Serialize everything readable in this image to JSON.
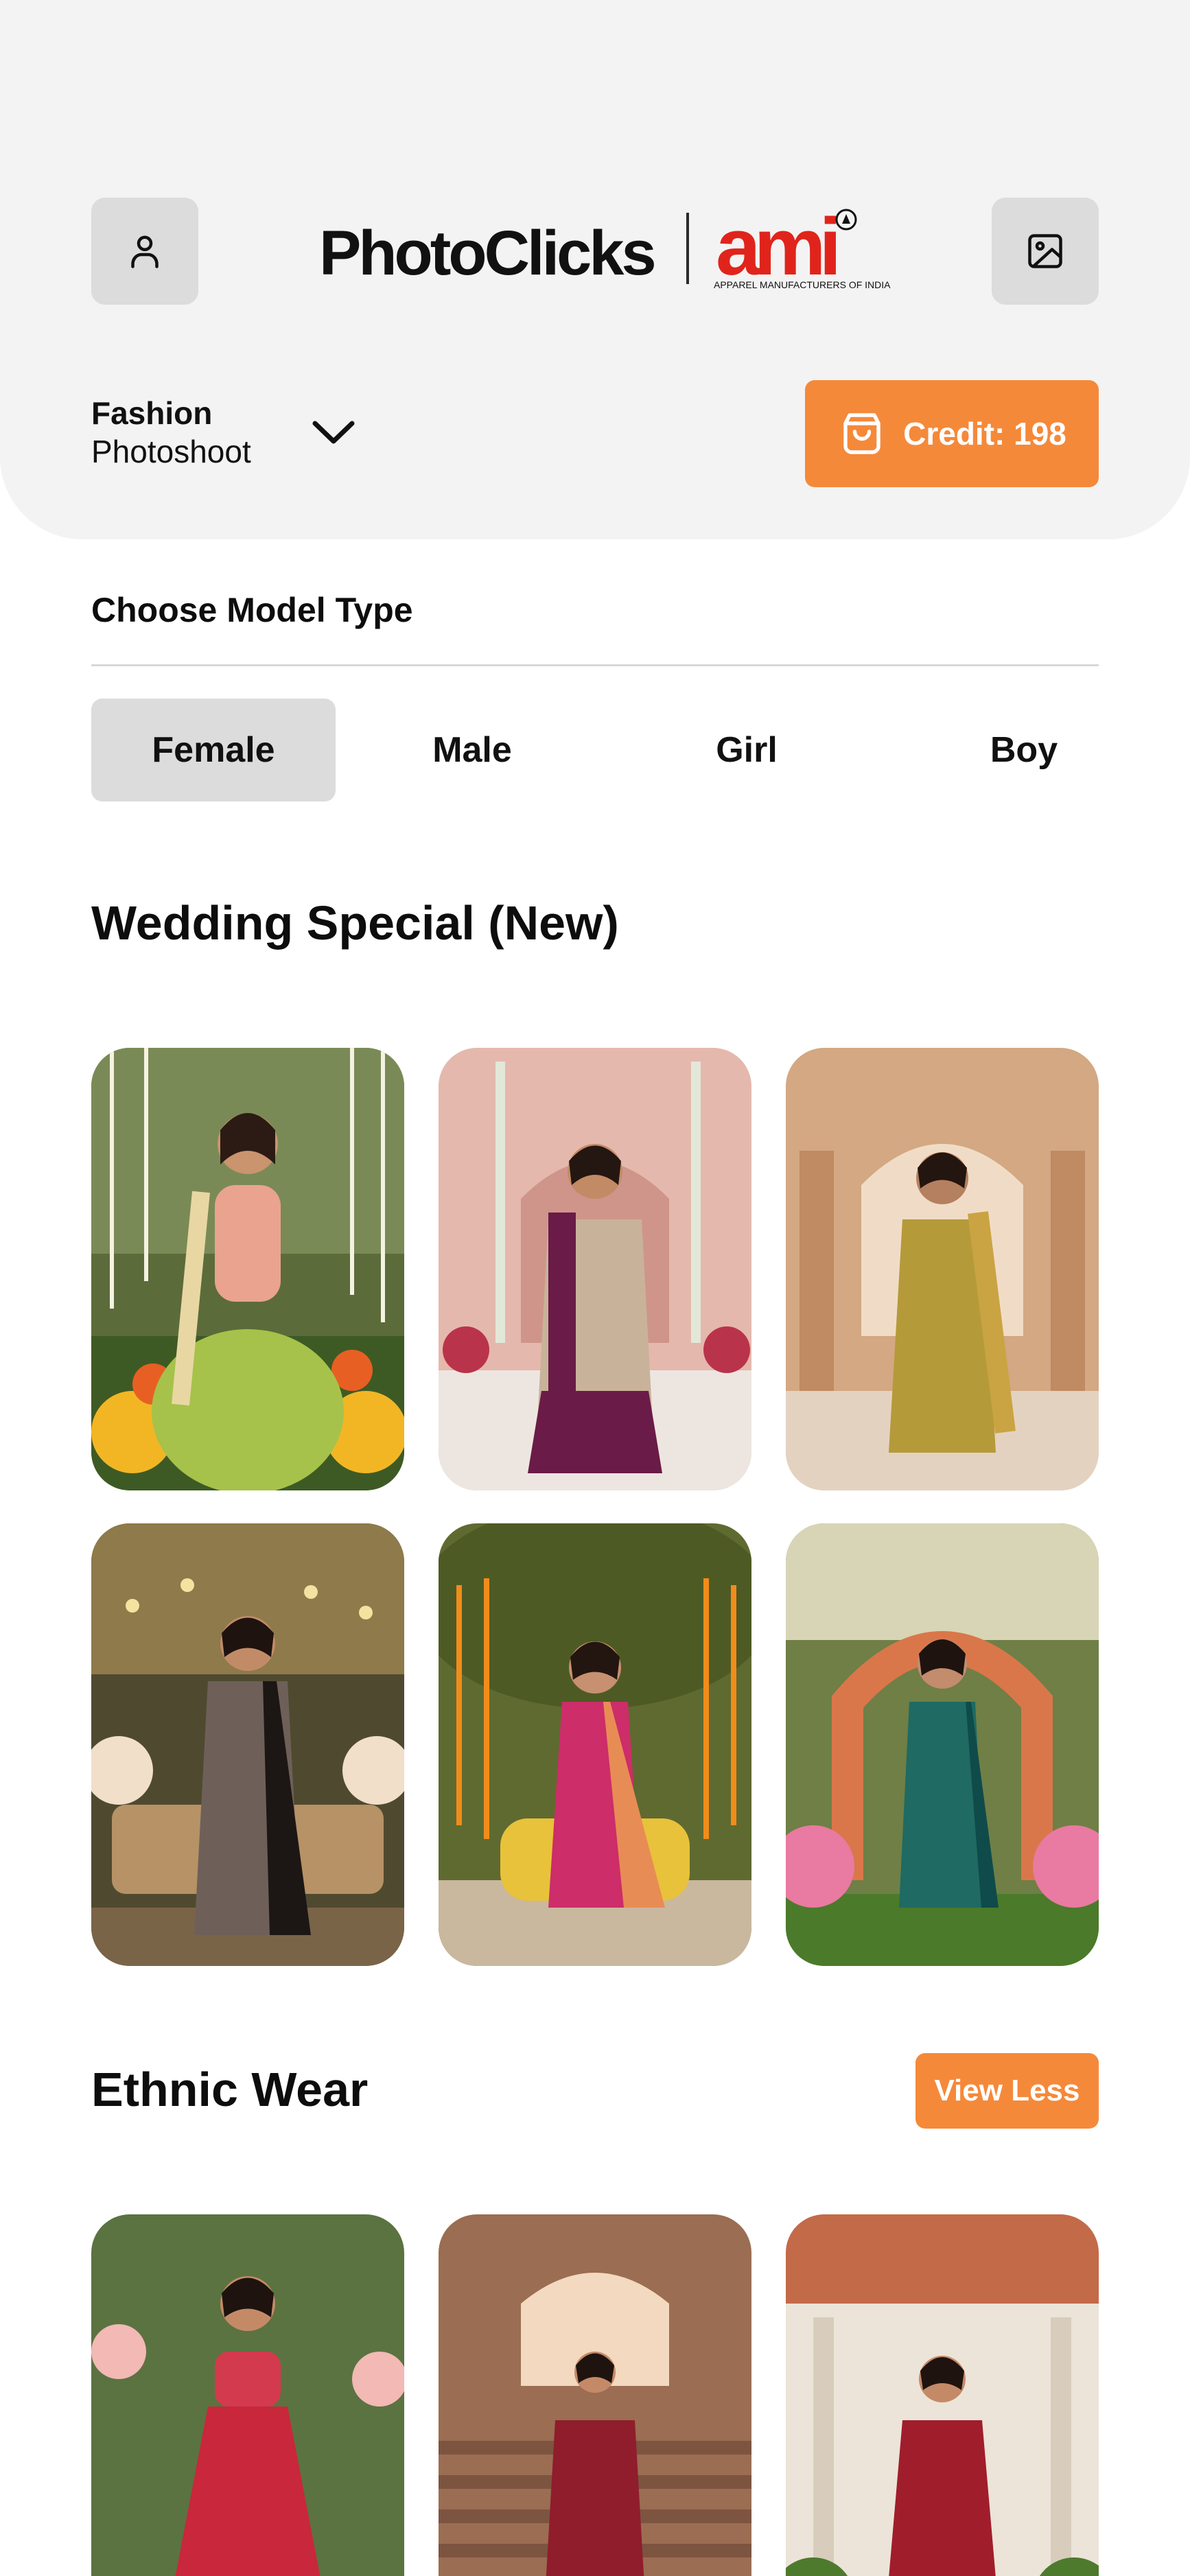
{
  "header": {
    "logo": {
      "name": "PhotoClicks",
      "partner": "ami",
      "partner_tagline": "APPAREL MANUFACTURERS OF INDIA"
    },
    "profile_icon": "user-icon",
    "gallery_icon": "image-icon",
    "shoot_type": {
      "line1": "Fashion",
      "line2": "Photoshoot"
    },
    "credit_label": "Credit: 198"
  },
  "model_type": {
    "label": "Choose Model Type",
    "options": [
      "Female",
      "Male",
      "Girl",
      "Boy"
    ],
    "selected": "Female"
  },
  "sections": [
    {
      "title": "Wedding Special (New)"
    },
    {
      "title": "Ethnic Wear",
      "action": "View Less"
    }
  ],
  "colors": {
    "accent": "#f5893a",
    "header_bg": "#f3f3f3",
    "chip_bg": "#dcdcdc"
  }
}
